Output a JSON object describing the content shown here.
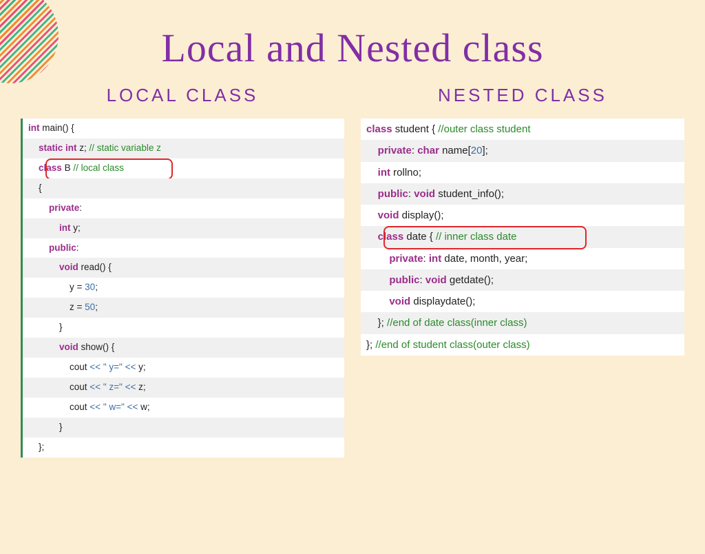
{
  "title": "Local and Nested class",
  "left": {
    "heading": "LOCAL CLASS",
    "lines": [
      {
        "alt": false,
        "indent": 0,
        "tokens": [
          [
            "kw",
            "int"
          ],
          [
            "ident",
            " main"
          ],
          [
            "ident",
            "() {"
          ]
        ]
      },
      {
        "alt": true,
        "indent": 1,
        "tokens": [
          [
            "kw",
            "static int"
          ],
          [
            "ident",
            " z; "
          ],
          [
            "cmt",
            "// static variable z"
          ]
        ]
      },
      {
        "alt": false,
        "indent": 1,
        "tokens": [
          [
            "kw",
            "class"
          ],
          [
            "ident",
            " B "
          ],
          [
            "cmt",
            "// local class"
          ]
        ],
        "redbox": true
      },
      {
        "alt": true,
        "indent": 1,
        "tokens": [
          [
            "ident",
            "{"
          ]
        ]
      },
      {
        "alt": false,
        "indent": 2,
        "tokens": [
          [
            "kw",
            "private"
          ],
          [
            "ident",
            ":"
          ]
        ]
      },
      {
        "alt": true,
        "indent": 3,
        "tokens": [
          [
            "kw",
            "int"
          ],
          [
            "ident",
            " y;"
          ]
        ]
      },
      {
        "alt": false,
        "indent": 2,
        "tokens": [
          [
            "kw",
            "public"
          ],
          [
            "ident",
            ":"
          ]
        ]
      },
      {
        "alt": true,
        "indent": 3,
        "tokens": [
          [
            "kw",
            "void"
          ],
          [
            "ident",
            " read() {"
          ]
        ]
      },
      {
        "alt": false,
        "indent": 4,
        "tokens": [
          [
            "ident",
            "y = "
          ],
          [
            "num",
            "30"
          ],
          [
            "ident",
            ";"
          ]
        ]
      },
      {
        "alt": true,
        "indent": 4,
        "tokens": [
          [
            "ident",
            "z = "
          ],
          [
            "num",
            "50"
          ],
          [
            "ident",
            ";"
          ]
        ]
      },
      {
        "alt": false,
        "indent": 3,
        "tokens": [
          [
            "ident",
            "}"
          ]
        ]
      },
      {
        "alt": true,
        "indent": 3,
        "tokens": [
          [
            "kw",
            "void"
          ],
          [
            "ident",
            " show() {"
          ]
        ]
      },
      {
        "alt": false,
        "indent": 4,
        "tokens": [
          [
            "ident",
            "cout "
          ],
          [
            "op",
            "<< "
          ],
          [
            "op",
            "\" y=\""
          ],
          [
            "op",
            " <<"
          ],
          [
            "ident",
            " y;"
          ]
        ]
      },
      {
        "alt": true,
        "indent": 4,
        "tokens": [
          [
            "ident",
            "cout "
          ],
          [
            "op",
            "<< "
          ],
          [
            "op",
            "\" z=\""
          ],
          [
            "op",
            " <<"
          ],
          [
            "ident",
            " z;"
          ]
        ]
      },
      {
        "alt": false,
        "indent": 4,
        "tokens": [
          [
            "ident",
            "cout "
          ],
          [
            "op",
            "<< "
          ],
          [
            "op",
            "\" w=\""
          ],
          [
            "op",
            " <<"
          ],
          [
            "ident",
            " w;"
          ]
        ]
      },
      {
        "alt": true,
        "indent": 3,
        "tokens": [
          [
            "ident",
            "}"
          ]
        ]
      },
      {
        "alt": false,
        "indent": 1,
        "tokens": [
          [
            "ident",
            "};"
          ]
        ]
      }
    ]
  },
  "right": {
    "heading": "NESTED CLASS",
    "lines": [
      {
        "alt": false,
        "indent": 0,
        "tokens": [
          [
            "kw",
            "class"
          ],
          [
            "ident",
            " student { "
          ],
          [
            "cmt",
            "//outer class student"
          ]
        ]
      },
      {
        "alt": true,
        "indent": 1,
        "tokens": [
          [
            "kw",
            "private"
          ],
          [
            "ident",
            ": "
          ],
          [
            "kw",
            "char"
          ],
          [
            "ident",
            " name["
          ],
          [
            "num",
            "20"
          ],
          [
            "ident",
            "];"
          ]
        ]
      },
      {
        "alt": false,
        "indent": 1,
        "tokens": [
          [
            "kw",
            "int"
          ],
          [
            "ident",
            " rollno;"
          ]
        ]
      },
      {
        "alt": true,
        "indent": 1,
        "tokens": [
          [
            "kw",
            "public"
          ],
          [
            "ident",
            ": "
          ],
          [
            "kw",
            "void"
          ],
          [
            "ident",
            " student_info();"
          ]
        ]
      },
      {
        "alt": false,
        "indent": 1,
        "tokens": [
          [
            "kw",
            "void"
          ],
          [
            "ident",
            " display();"
          ]
        ]
      },
      {
        "alt": true,
        "indent": 1,
        "tokens": [
          [
            "kw",
            "class"
          ],
          [
            "ident",
            " date { "
          ],
          [
            "cmt",
            "// inner class date"
          ]
        ],
        "redbox": true
      },
      {
        "alt": false,
        "indent": 2,
        "tokens": [
          [
            "kw",
            "private"
          ],
          [
            "ident",
            ": "
          ],
          [
            "kw",
            "int"
          ],
          [
            "ident",
            " date, month, year;"
          ]
        ]
      },
      {
        "alt": true,
        "indent": 2,
        "tokens": [
          [
            "kw",
            "public"
          ],
          [
            "ident",
            ": "
          ],
          [
            "kw",
            "void"
          ],
          [
            "ident",
            " getdate();"
          ]
        ]
      },
      {
        "alt": false,
        "indent": 2,
        "tokens": [
          [
            "kw",
            "void"
          ],
          [
            "ident",
            " displaydate();"
          ]
        ]
      },
      {
        "alt": true,
        "indent": 1,
        "tokens": [
          [
            "ident",
            "}; "
          ],
          [
            "cmt",
            "//end of date class(inner class)"
          ]
        ]
      },
      {
        "alt": false,
        "indent": 0,
        "tokens": [
          [
            "ident",
            "}; "
          ],
          [
            "cmt",
            "//end of student class(outer class)"
          ]
        ]
      }
    ]
  }
}
